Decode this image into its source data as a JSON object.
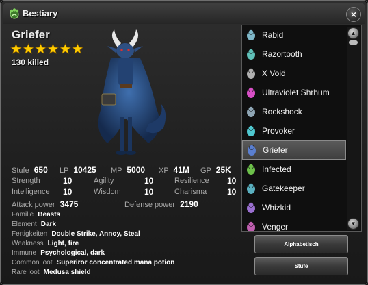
{
  "window": {
    "title": "Bestiary",
    "close_label": "×"
  },
  "monster": {
    "name": "Griefer",
    "stars": 6,
    "killed": "130 killed"
  },
  "stats": {
    "stufe_label": "Stufe",
    "stufe": "650",
    "lp_label": "LP",
    "lp": "10425",
    "mp_label": "MP",
    "mp": "5000",
    "xp_label": "XP",
    "xp": "41M",
    "gp_label": "GP",
    "gp": "25K",
    "strength_label": "Strength",
    "strength": "10",
    "agility_label": "Agility",
    "agility": "10",
    "resilience_label": "Resilience",
    "resilience": "10",
    "intelligence_label": "Intelligence",
    "intelligence": "10",
    "wisdom_label": "Wisdom",
    "wisdom": "10",
    "charisma_label": "Charisma",
    "charisma": "10",
    "attack_label": "Attack power",
    "attack": "3475",
    "defense_label": "Defense power",
    "defense": "2190",
    "familie_label": "Familie",
    "familie": "Beasts",
    "element_label": "Element",
    "element": "Dark",
    "fertigkeiten_label": "Fertigkeiten",
    "fertigkeiten": "Double Strike, Annoy, Steal",
    "weakness_label": "Weakness",
    "weakness": "Light, fire",
    "immune_label": "Immune",
    "immune": "Psychological, dark",
    "common_loot_label": "Common loot",
    "common_loot": "Superiror concentrated mana potion",
    "rare_loot_label": "Rare loot",
    "rare_loot": "Medusa shield"
  },
  "list": {
    "items": [
      {
        "label": "Rabid",
        "icon": "rabid-icon",
        "color": "#7fb8c9"
      },
      {
        "label": "Razortooth",
        "icon": "razortooth-icon",
        "color": "#5fc0b8"
      },
      {
        "label": "X Void",
        "icon": "x-void-icon",
        "color": "#b0b0b0"
      },
      {
        "label": "Ultraviolet Shrhum",
        "icon": "ultraviolet-shrhum-icon",
        "color": "#d84fc6"
      },
      {
        "label": "Rockshock",
        "icon": "rockshock-icon",
        "color": "#8fa6b5"
      },
      {
        "label": "Provoker",
        "icon": "provoker-icon",
        "color": "#4fc8d0"
      },
      {
        "label": "Griefer",
        "icon": "griefer-icon",
        "color": "#5a7fd0",
        "selected": true
      },
      {
        "label": "Infected",
        "icon": "infected-icon",
        "color": "#6cc04a"
      },
      {
        "label": "Gatekeeper",
        "icon": "gatekeeper-icon",
        "color": "#5ab0c0"
      },
      {
        "label": "Whizkid",
        "icon": "whizkid-icon",
        "color": "#9a6fd0"
      },
      {
        "label": "Venger",
        "icon": "venger-icon",
        "color": "#c05fb0"
      }
    ]
  },
  "buttons": {
    "alphabetisch": "Alphabetisch",
    "stufe": "Stufe"
  },
  "colors": {
    "star": "#ffcc00",
    "selected_row": "#4d4d4d",
    "label_grey": "#a9a9a9"
  }
}
